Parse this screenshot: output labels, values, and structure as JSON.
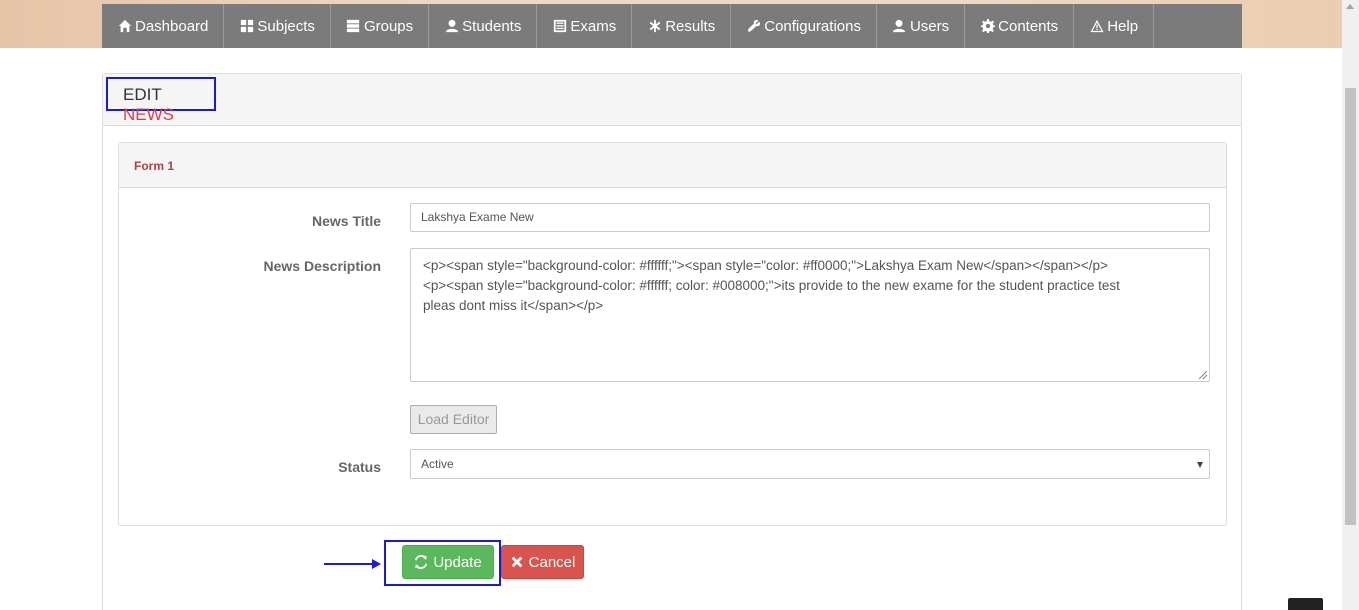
{
  "nav": {
    "items": [
      {
        "label": "Dashboard",
        "icon": "home-icon"
      },
      {
        "label": "Subjects",
        "icon": "grid-icon"
      },
      {
        "label": "Groups",
        "icon": "server-icon"
      },
      {
        "label": "Students",
        "icon": "user-icon"
      },
      {
        "label": "Exams",
        "icon": "list-icon"
      },
      {
        "label": "Results",
        "icon": "asterisk-icon"
      },
      {
        "label": "Configurations",
        "icon": "wrench-icon"
      },
      {
        "label": "Users",
        "icon": "user-icon"
      },
      {
        "label": "Contents",
        "icon": "gear-icon"
      },
      {
        "label": "Help",
        "icon": "warning-icon"
      }
    ]
  },
  "header": {
    "title_prefix": "EDIT",
    "title_highlight": "NEWS"
  },
  "form": {
    "heading": "Form 1",
    "news_title_label": "News Title",
    "news_title_value": "Lakshya Exame New",
    "news_description_label": "News Description",
    "news_description_lines": [
      "<p><span style=\"background-color: #ffffff;\"><span style=\"color: #ff0000;\">Lakshya Exam New</span></span></p>",
      "<p><span style=\"background-color: #ffffff; color: #008000;\">its provide to the new exame for the student practice test",
      "pleas dont miss it</span></p>"
    ],
    "load_editor_label": "Load Editor",
    "status_label": "Status",
    "status_value": "Active"
  },
  "actions": {
    "update_label": "Update",
    "cancel_label": "Cancel"
  },
  "colors": {
    "nav_bg": "#7b7b7b",
    "highlight_red": "#e23c3c",
    "form_heading": "#a94442",
    "update_green": "#5cb85c",
    "cancel_red": "#d9534f",
    "annotation_blue": "#1b1bd6"
  }
}
